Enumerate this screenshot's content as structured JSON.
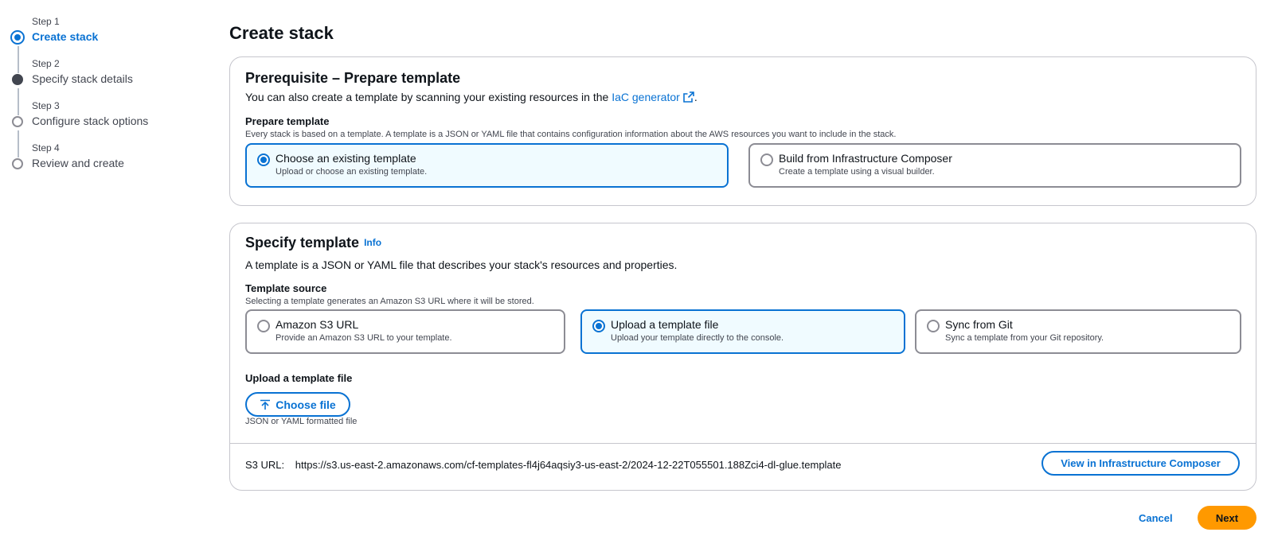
{
  "steps": [
    {
      "num": "Step 1",
      "title": "Create stack",
      "state": "active"
    },
    {
      "num": "Step 2",
      "title": "Specify stack details",
      "state": "visited"
    },
    {
      "num": "Step 3",
      "title": "Configure stack options",
      "state": "upcoming"
    },
    {
      "num": "Step 4",
      "title": "Review and create",
      "state": "upcoming"
    }
  ],
  "page": {
    "title": "Create stack"
  },
  "prerequisite": {
    "header": "Prerequisite – Prepare template",
    "desc_prefix": "You can also create a template by scanning your existing resources in the",
    "desc_link": "IaC generator",
    "desc_suffix": ".",
    "field_label": "Prepare template",
    "field_desc": "Every stack is based on a template. A template is a JSON or YAML file that contains configuration information about the AWS resources you want to include in the stack.",
    "options": [
      {
        "label": "Choose an existing template",
        "desc": "Upload or choose an existing template.",
        "selected": true
      },
      {
        "label": "Build from Infrastructure Composer",
        "desc": "Create a template using a visual builder.",
        "selected": false
      }
    ]
  },
  "specify": {
    "header": "Specify template",
    "info": "Info",
    "desc": "A template is a JSON or YAML file that describes your stack's resources and properties.",
    "source_label": "Template source",
    "source_desc": "Selecting a template generates an Amazon S3 URL where it will be stored.",
    "options": [
      {
        "label": "Amazon S3 URL",
        "desc": "Provide an Amazon S3 URL to your template.",
        "selected": false
      },
      {
        "label": "Upload a template file",
        "desc": "Upload your template directly to the console.",
        "selected": true
      },
      {
        "label": "Sync from Git",
        "desc": "Sync a template from your Git repository.",
        "selected": false
      }
    ],
    "upload_label": "Upload a template file",
    "choose_file": "Choose file",
    "format_hint": "JSON or YAML formatted file",
    "s3_key": "S3 URL:",
    "s3_value": "https://s3.us-east-2.amazonaws.com/cf-templates-fl4j64aqsiy3-us-east-2/2024-12-22T055501.188Zci4-dl-glue.template",
    "view_button": "View in Infrastructure Composer"
  },
  "footer": {
    "cancel": "Cancel",
    "next": "Next"
  },
  "colors": {
    "primary": "#0972d3",
    "accent": "#ff9900",
    "selected_bg": "#f0fbff"
  },
  "icons": {
    "external": "external-link-icon",
    "upload": "upload-icon"
  }
}
